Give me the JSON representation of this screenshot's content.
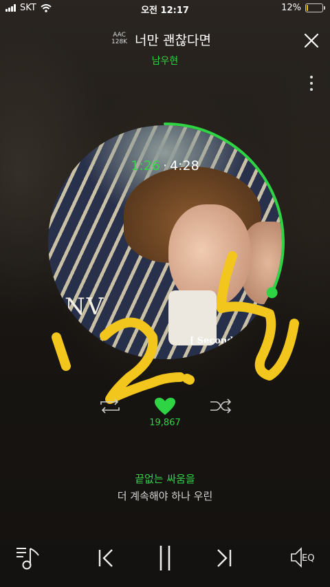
{
  "status_bar": {
    "carrier": "SKT",
    "time": "오전 12:17",
    "battery_percent": "12%",
    "battery_level": 0.12,
    "battery_color": "#f5c400"
  },
  "player": {
    "quality_codec": "AAC",
    "quality_bitrate": "128K",
    "song_title": "너만 괜찮다면",
    "artist": "남우현",
    "current_time": "1:26",
    "time_separator": "·",
    "duration": "4:28",
    "progress": 0.32,
    "likes": "19,867",
    "liked": true,
    "accent_color": "#2fd444"
  },
  "album_art": {
    "logo_text": "NV",
    "edition_text": "[ Second"
  },
  "overlay_handwriting": "12.5",
  "lyrics": {
    "current": "끝없는 싸움을",
    "next": "더 계속해야 하나 우린"
  },
  "controls": {
    "repeat": "repeat-icon",
    "like": "heart-icon",
    "shuffle": "shuffle-icon",
    "playlist": "playlist-icon",
    "previous": "previous-icon",
    "pause": "pause-icon",
    "next": "next-icon",
    "eq_label": "EQ",
    "close": "close-icon",
    "more": "more-vertical-icon"
  }
}
